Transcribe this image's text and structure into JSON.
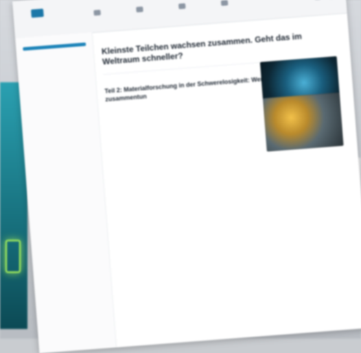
{
  "page": {
    "title": "Kleinste Teilchen wachsen zusammen. Geht das im Weltraum schneller?",
    "section_title": "Teil 2: Materialforschung in der Schwerelosigkeit: Wenn Nanoteilchen sich zusammentun"
  },
  "colors": {
    "accent": "#1a82b8",
    "text": "#3e4a57",
    "heading": "#1f2833",
    "background": "#ffffff"
  }
}
